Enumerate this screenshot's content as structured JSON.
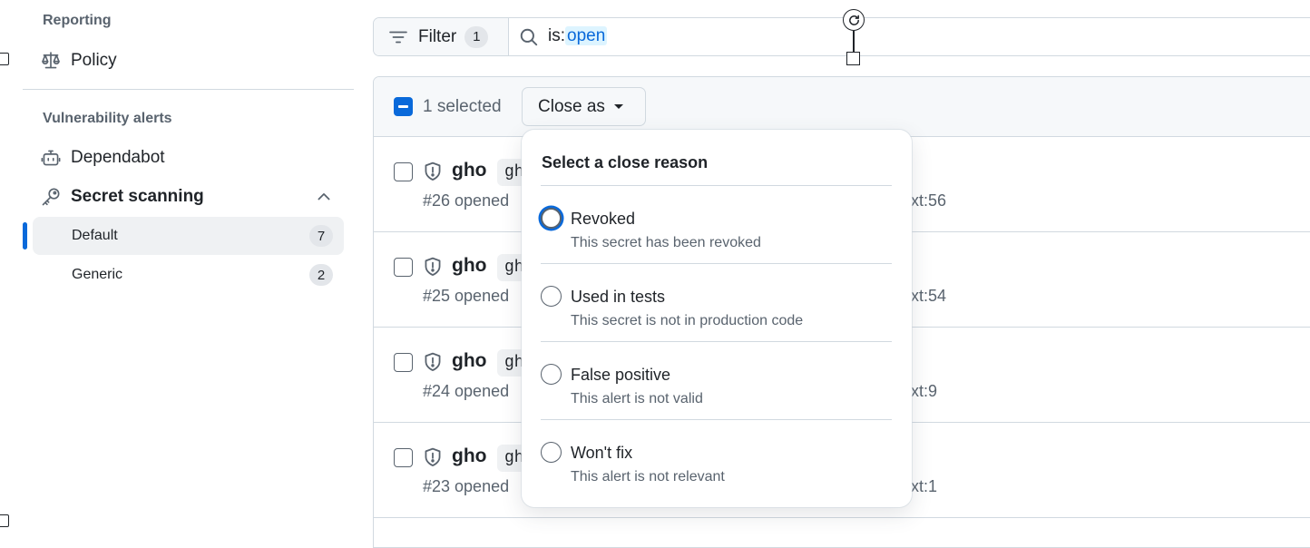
{
  "sidebar": {
    "reporting_title": "Reporting",
    "policy_label": "Policy",
    "vuln_title": "Vulnerability alerts",
    "dependabot_label": "Dependabot",
    "secret_scanning_label": "Secret scanning",
    "sub_items": [
      {
        "label": "Default",
        "count": "7",
        "active": true
      },
      {
        "label": "Generic",
        "count": "2",
        "active": false
      }
    ]
  },
  "filter": {
    "button_label": "Filter",
    "count": "1",
    "query_key": "is:",
    "query_value": "open"
  },
  "list": {
    "selected_text": "1 selected",
    "close_as_label": "Close as",
    "rows": [
      {
        "title": "gho",
        "chip": "gh",
        "meta": "#26 opened",
        "loc": "xt:56"
      },
      {
        "title": "gho",
        "chip": "gh",
        "meta": "#25 opened",
        "loc": "xt:54"
      },
      {
        "title": "gho",
        "chip": "gh",
        "meta": "#24 opened",
        "loc": "xt:9"
      },
      {
        "title": "gho",
        "chip": "gh",
        "meta": "#23 opened",
        "loc": "xt:1"
      }
    ]
  },
  "dropdown": {
    "header": "Select a close reason",
    "options": [
      {
        "label": "Revoked",
        "description": "This secret has been revoked"
      },
      {
        "label": "Used in tests",
        "description": "This secret is not in production code"
      },
      {
        "label": "False positive",
        "description": "This alert is not valid"
      },
      {
        "label": "Won't fix",
        "description": "This alert is not relevant"
      }
    ]
  },
  "colors": {
    "accent": "#0969da",
    "text": "#1f2328",
    "muted": "#59636e",
    "border": "#d1d9e0",
    "subtle_bg": "#f6f8fa"
  },
  "icons": [
    "law-icon",
    "dependabot-icon",
    "key-icon",
    "chevron-up-icon",
    "filter-icon",
    "search-icon",
    "rotate-icon",
    "shield-icon"
  ]
}
